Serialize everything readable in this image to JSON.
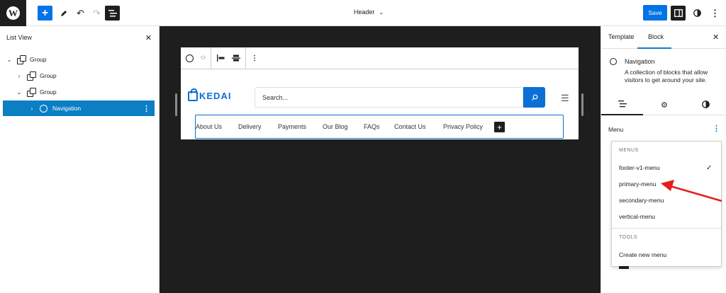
{
  "topbar": {
    "document_title": "Header",
    "save_label": "Save"
  },
  "list_view": {
    "title": "List View",
    "items": [
      {
        "label": "Group"
      },
      {
        "label": "Group"
      },
      {
        "label": "Group"
      },
      {
        "label": "Navigation"
      }
    ]
  },
  "canvas": {
    "logo_text": "KEDAI",
    "search_placeholder": "Search...",
    "nav_items": [
      "About Us",
      "Delivery",
      "Payments",
      "Our Blog",
      "FAQs",
      "Contact Us",
      "Privacy Policy"
    ]
  },
  "inspector": {
    "tabs": [
      "Template",
      "Block"
    ],
    "block_name": "Navigation",
    "block_description": "A collection of blocks that allow visitors to get around your site.",
    "menu_label": "Menu",
    "dropdown": {
      "menus_heading": "MENUS",
      "menus": [
        "footer-v1-menu",
        "primary-menu",
        "secondary-menu",
        "vertical-menu"
      ],
      "tools_heading": "TOOLS",
      "tools": [
        "Create new menu"
      ]
    }
  },
  "colors": {
    "accent": "#0073e6",
    "selection": "#0b7ec4",
    "brand": "#0b6fd6",
    "canvas_bg": "#1e1e1e",
    "annotation_arrow": "#e51c1c"
  }
}
